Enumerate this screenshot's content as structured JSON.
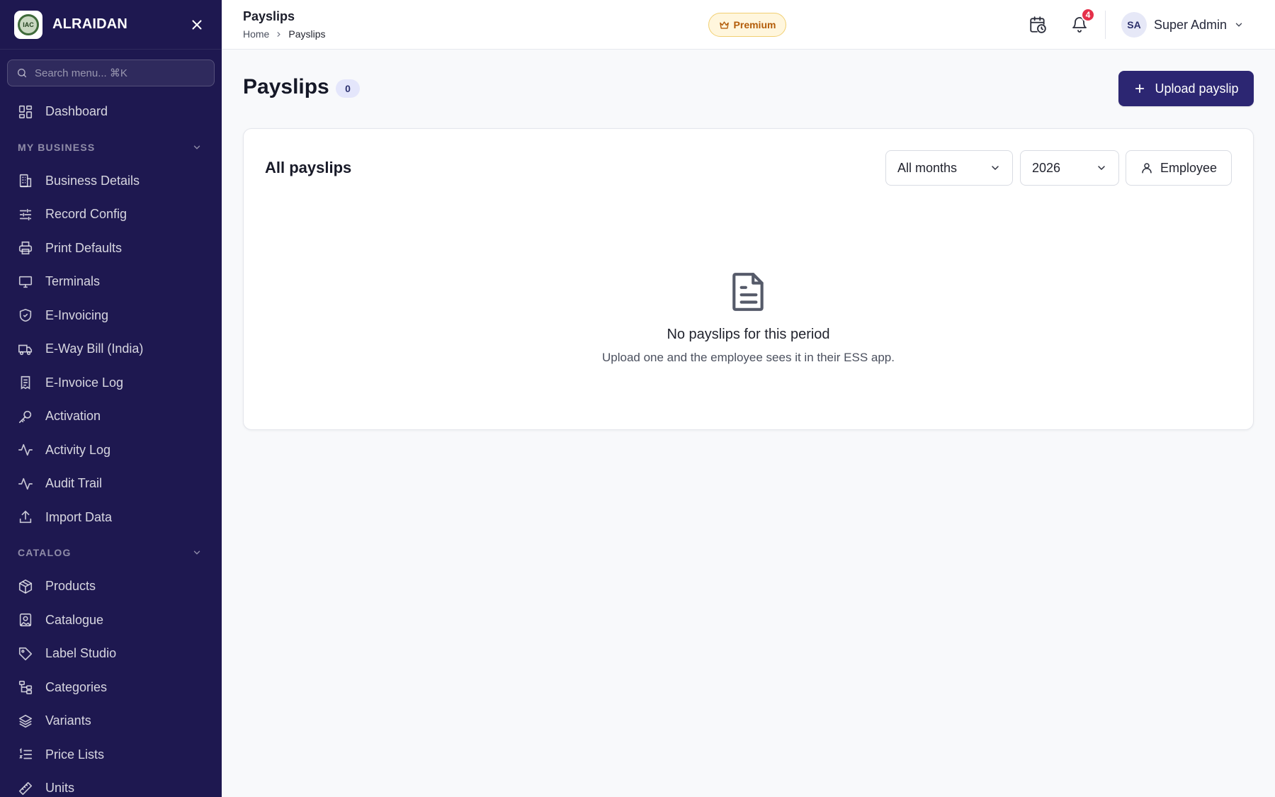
{
  "sidebar": {
    "brand": "ALRAIDAN",
    "logo_text": "IAC",
    "search_placeholder": "Search menu... ⌘K",
    "dashboard_label": "Dashboard",
    "sections": [
      {
        "title": "MY BUSINESS",
        "items": [
          {
            "label": "Business Details",
            "icon": "building-icon"
          },
          {
            "label": "Record Config",
            "icon": "sliders-icon"
          },
          {
            "label": "Print Defaults",
            "icon": "printer-icon"
          },
          {
            "label": "Terminals",
            "icon": "monitor-icon"
          },
          {
            "label": "E-Invoicing",
            "icon": "shield-check-icon"
          },
          {
            "label": "E-Way Bill (India)",
            "icon": "truck-icon"
          },
          {
            "label": "E-Invoice Log",
            "icon": "receipt-icon"
          },
          {
            "label": "Activation",
            "icon": "key-icon"
          },
          {
            "label": "Activity Log",
            "icon": "activity-icon"
          },
          {
            "label": "Audit Trail",
            "icon": "activity-icon"
          },
          {
            "label": "Import Data",
            "icon": "upload-icon"
          }
        ]
      },
      {
        "title": "CATALOG",
        "items": [
          {
            "label": "Products",
            "icon": "package-icon"
          },
          {
            "label": "Catalogue",
            "icon": "image-icon"
          },
          {
            "label": "Label Studio",
            "icon": "tag-icon"
          },
          {
            "label": "Categories",
            "icon": "tree-icon"
          },
          {
            "label": "Variants",
            "icon": "layers-icon"
          },
          {
            "label": "Price Lists",
            "icon": "list-ordered-icon"
          },
          {
            "label": "Units",
            "icon": "ruler-icon"
          }
        ]
      }
    ]
  },
  "topbar": {
    "title": "Payslips",
    "breadcrumb": {
      "home": "Home",
      "current": "Payslips"
    },
    "premium_label": "Premium",
    "notification_count": "4",
    "user": {
      "initials": "SA",
      "name": "Super Admin"
    }
  },
  "main": {
    "title": "Payslips",
    "count": "0",
    "upload_label": "Upload payslip",
    "card": {
      "title": "All payslips",
      "month_filter": "All months",
      "year_filter": "2026",
      "employee_label": "Employee",
      "empty_title": "No payslips for this period",
      "empty_subtitle": "Upload one and the employee sees it in their ESS app."
    }
  },
  "colors": {
    "sidebar_bg": "#1e1850",
    "primary": "#2c2672",
    "premium_bg": "#fff6dd",
    "premium_text": "#b35d0a",
    "badge": "#e5304a"
  }
}
